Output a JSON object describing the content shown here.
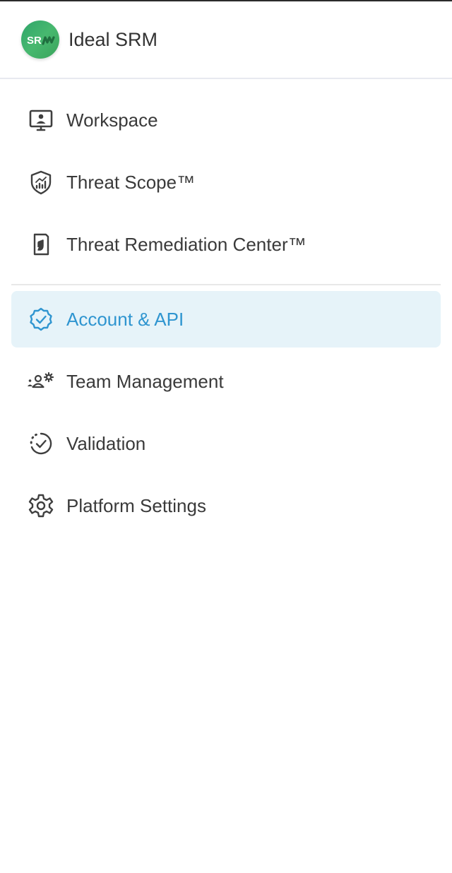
{
  "brand": {
    "name": "Ideal SRM",
    "logo_text": "SRM",
    "logo_color": "#3aa566"
  },
  "nav_primary": [
    {
      "label": "Workspace",
      "icon": "monitor-user-icon"
    },
    {
      "label": "Threat Scope™",
      "icon": "shield-chart-icon"
    },
    {
      "label": "Threat Remediation Center™",
      "icon": "document-hand-icon"
    }
  ],
  "nav_secondary": [
    {
      "label": "Account & API",
      "icon": "verified-badge-icon",
      "active": true
    },
    {
      "label": "Team Management",
      "icon": "team-gear-icon",
      "active": false
    },
    {
      "label": "Validation",
      "icon": "dashed-check-circle-icon",
      "active": false
    },
    {
      "label": "Platform Settings",
      "icon": "gear-icon",
      "active": false
    }
  ],
  "colors": {
    "active_text": "#2f95d0",
    "active_bg": "#e6f3f9"
  }
}
